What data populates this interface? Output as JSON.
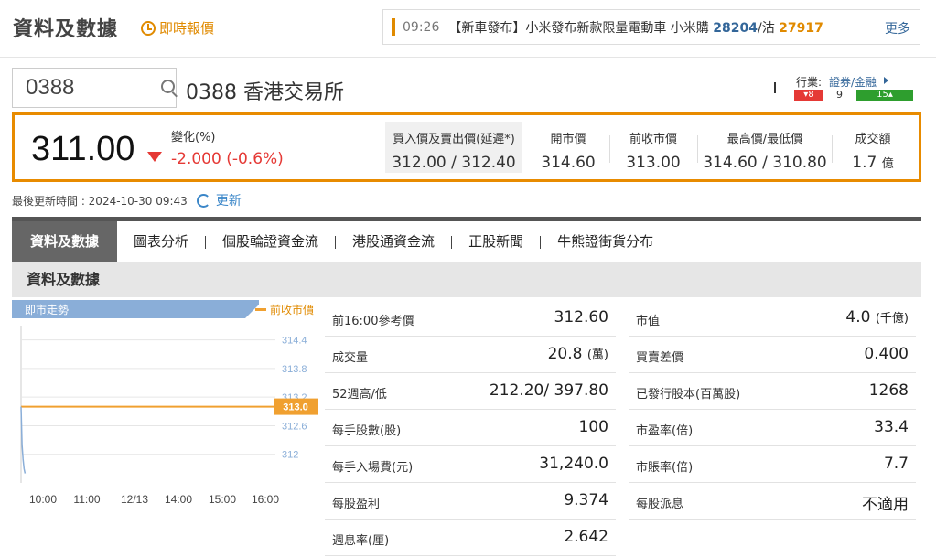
{
  "header": {
    "title": "資料及數據",
    "realtime_link": "即時報價"
  },
  "ticker": {
    "time": "09:26",
    "text": "【新車發布】小米發布新款限量電動車 小米購 ",
    "num1": "28204",
    "sep": "/沽 ",
    "num2": "27917",
    "more": "更多"
  },
  "search": {
    "value": "0388",
    "placeholder": ""
  },
  "stock": {
    "name": "0388 香港交易所"
  },
  "industry": {
    "label": "行業:",
    "link": "證券/金融",
    "down": "▾8",
    "flat": "9",
    "up": "15▴"
  },
  "quote": {
    "price": "311.00",
    "change_label": "變化(%)",
    "change_value": "-2.000 (-0.6%)",
    "bidask_label": "買入價及賣出價(延遲*)",
    "bidask_value": "312.00 / 312.40",
    "open_label": "開市價",
    "open_value": "314.60",
    "prev_close_label": "前收市價",
    "prev_close_value": "313.00",
    "high_low_label": "最高價/最低價",
    "high_low_value": "314.60 / 310.80",
    "turnover_label": "成交額",
    "turnover_value": "1.7",
    "turnover_unit": "億"
  },
  "last_update": {
    "text": "最後更新時間 : 2024-10-30 09:43",
    "refresh": "更新"
  },
  "tabs": [
    "資料及數據",
    "圖表分析",
    "個股輪證資金流",
    "港股通資金流",
    "正股新聞",
    "牛熊證街貨分布"
  ],
  "section_title": "資料及數據",
  "chart_labels": {
    "trend": "即市走勢",
    "prev_close": "前收市價"
  },
  "chart_data": {
    "type": "line",
    "title": "即市走勢",
    "xlabel": "",
    "ylabel": "",
    "x_ticks": [
      "10:00",
      "11:00",
      "12/13",
      "14:00",
      "15:00",
      "16:00"
    ],
    "y_ticks": [
      "314.4",
      "313.8",
      "313.2",
      "312.6",
      "312"
    ],
    "ylim": [
      311.4,
      314.7
    ],
    "reference_line": {
      "name": "前收市價",
      "value": 313.0,
      "label": "313.0",
      "color": "#f0a030"
    },
    "series": [
      {
        "color": "#8aaed8",
        "x_minutes": [
          0,
          1,
          2,
          3,
          4
        ],
        "values": [
          313.0,
          312.2,
          311.9,
          311.7,
          311.6
        ]
      }
    ],
    "grid": true
  },
  "stats_left": [
    {
      "label": "前16:00參考價",
      "value": "312.60",
      "unit": ""
    },
    {
      "label": "成交量",
      "value": "20.8",
      "unit": "(萬)"
    },
    {
      "label": "52週高/低",
      "value": "212.20/ 397.80",
      "unit": ""
    },
    {
      "label": "每手股數(股)",
      "value": "100",
      "unit": ""
    },
    {
      "label": "每手入場費(元)",
      "value": "31,240.0",
      "unit": ""
    },
    {
      "label": "每股盈利",
      "value": "9.374",
      "unit": ""
    },
    {
      "label": "週息率(厘)",
      "value": "2.642",
      "unit": ""
    }
  ],
  "stats_right": [
    {
      "label": "市值",
      "value": "4.0",
      "unit": "(千億)"
    },
    {
      "label": "買賣差價",
      "value": "0.400",
      "unit": ""
    },
    {
      "label": "已發行股本(百萬股)",
      "value": "1268",
      "unit": ""
    },
    {
      "label": "市盈率(倍)",
      "value": "33.4",
      "unit": ""
    },
    {
      "label": "市賬率(倍)",
      "value": "7.7",
      "unit": ""
    },
    {
      "label": "每股派息",
      "value": "不適用",
      "unit": ""
    }
  ],
  "colors": {
    "accent": "#e88b00",
    "down": "#e53935",
    "up": "#2e9e2e",
    "link": "#336699"
  }
}
